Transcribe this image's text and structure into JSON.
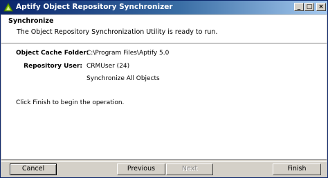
{
  "window": {
    "title": "Aptify Object Repository Synchronizer",
    "controls": {
      "minimize": "_",
      "maximize": "□",
      "close": "×"
    }
  },
  "header": {
    "title": "Synchronize",
    "subtitle": "The Object Repository Synchronization Utility is ready to run."
  },
  "fields": {
    "cache_folder_label": "Object Cache Folder:",
    "cache_folder_value": "C:\\Program Files\\Aptify 5.0",
    "repository_user_label": "Repository User:",
    "repository_user_value": "CRMUser (24)",
    "mode_value": "Synchronize All Objects"
  },
  "instruction": "Click Finish to begin the operation.",
  "buttons": {
    "cancel": "Cancel",
    "previous": "Previous",
    "next": "Next",
    "finish": "Finish"
  },
  "colors": {
    "titlebar_start": "#0a246a",
    "titlebar_end": "#a6caf0",
    "face": "#d4d0c8"
  }
}
